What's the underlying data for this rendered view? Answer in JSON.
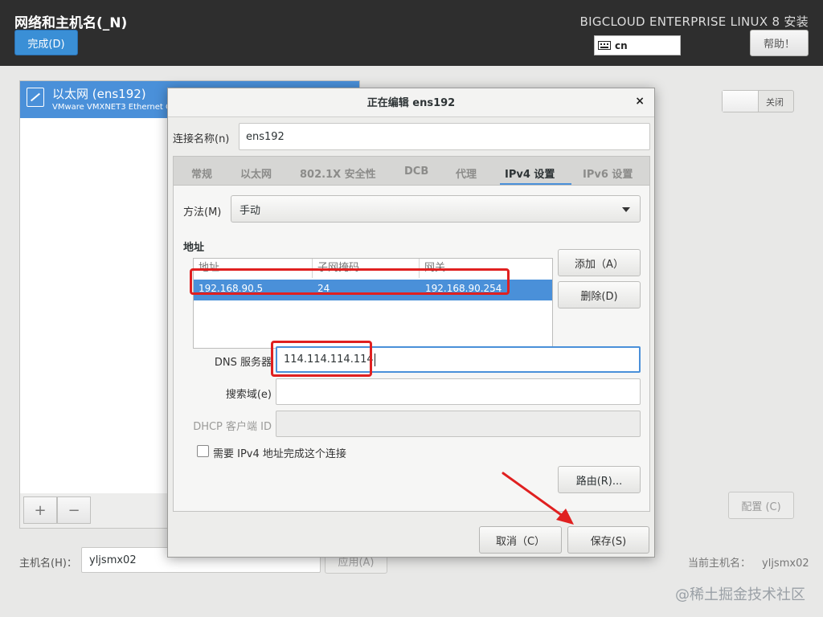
{
  "header": {
    "title": "网络和主机名(_N)",
    "done_label": "完成(D)",
    "product": "BIGCLOUD ENTERPRISE LINUX 8 安装",
    "keyboard_layout": "cn",
    "help_label": "帮助！"
  },
  "network_list": {
    "items": [
      {
        "name": "以太网 (ens192)",
        "subtitle": "VMware VMXNET3 Ethernet C"
      }
    ],
    "add_label": "+",
    "remove_label": "−"
  },
  "toggle": {
    "state_label": "关闭"
  },
  "configure_label": "配置 (C)",
  "hostname": {
    "label": "主机名(H)：",
    "value": "yljsmx02",
    "apply_label": "应用(A)",
    "current_label": "当前主机名：",
    "current_value": "yljsmx02"
  },
  "watermark": "@稀土掘金技术社区",
  "dialog": {
    "title": "正在编辑 ens192",
    "close_glyph": "×",
    "connection_name_label": "连接名称(n)",
    "connection_name_value": "ens192",
    "tabs": [
      {
        "label": "常规",
        "active": false
      },
      {
        "label": "以太网",
        "active": false
      },
      {
        "label": "802.1X 安全性",
        "active": false
      },
      {
        "label": "DCB",
        "active": false
      },
      {
        "label": "代理",
        "active": false
      },
      {
        "label": "IPv4 设置",
        "active": true
      },
      {
        "label": "IPv6 设置",
        "active": false
      }
    ],
    "method_label": "方法(M)",
    "method_value": "手动",
    "address_section": "地址",
    "address_columns": [
      "地址",
      "子网掩码",
      "网关"
    ],
    "address_rows": [
      {
        "address": "192.168.90.5",
        "netmask": "24",
        "gateway": "192.168.90.254"
      }
    ],
    "add_label": "添加（A）",
    "delete_label": "删除(D)",
    "dns_label": "DNS 服务器",
    "dns_value": "114.114.114.114",
    "search_label": "搜索域(e)",
    "search_value": "",
    "dhcp_label": "DHCP 客户端 ID",
    "dhcp_value": "",
    "require_ipv4_label": "需要 IPv4 地址完成这个连接",
    "require_ipv4_checked": false,
    "routes_label": "路由(R)...",
    "cancel_label": "取消（C）",
    "save_label": "保存(S)"
  },
  "colors": {
    "accent": "#4a90d9",
    "highlight": "#e02020",
    "header_bg": "#2e2e2e"
  }
}
